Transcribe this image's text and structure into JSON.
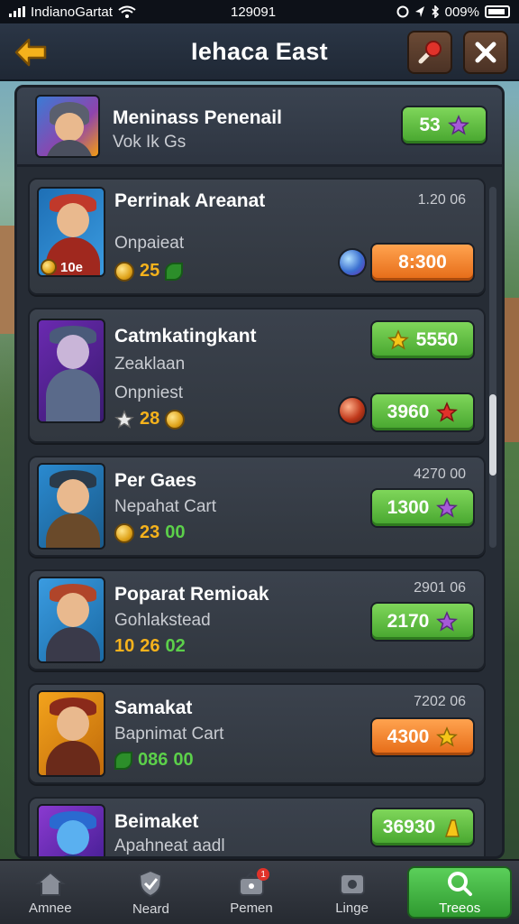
{
  "status_bar": {
    "carrier": "IndianoGartat",
    "time": "129091",
    "battery": "009%"
  },
  "header": {
    "title": "Iehaca East"
  },
  "top_item": {
    "title": "Meninass Penenail",
    "subtitle": "Vok Ik Gs",
    "price": "53"
  },
  "items": [
    {
      "title": "Perrinak Areanat",
      "time": "1.20 06",
      "line1": "Onpaieat",
      "stats": [
        "25"
      ],
      "level": "10e",
      "price": "8:300",
      "button_color": "orange"
    },
    {
      "title": "Catmkatingkant",
      "line1": "Zeaklaan",
      "line2": "Onpniest",
      "stats": [
        "28"
      ],
      "price_top": "5550",
      "price": "3960",
      "button_color": "green"
    },
    {
      "title": "Per Gaes",
      "time": "4270 00",
      "line1": "Nepahat Cart",
      "stats": [
        "23",
        "00"
      ],
      "price": "1300",
      "button_color": "green"
    },
    {
      "title": "Poparat Remioak",
      "time": "2901 06",
      "line1": "Gohlakstead",
      "stats": [
        "10",
        "26",
        "02"
      ],
      "price": "2170",
      "button_color": "green"
    },
    {
      "title": "Samakat",
      "time": "7202 06",
      "line1": "Bapnimat Cart",
      "stats": [
        "086",
        "00"
      ],
      "price": "4300",
      "button_color": "orange"
    },
    {
      "title": "Beimaket",
      "line1": "Apahneat aadl",
      "price": "36930",
      "button_color": "green"
    }
  ],
  "bottom_nav": [
    {
      "label": "Amnee",
      "icon": "home-icon"
    },
    {
      "label": "Neard",
      "icon": "shield-check-icon"
    },
    {
      "label": "Pemen",
      "icon": "bag-icon",
      "badge": "1"
    },
    {
      "label": "Linge",
      "icon": "chest-icon"
    },
    {
      "label": "Treeos",
      "icon": "search-icon",
      "active": true
    }
  ],
  "colors": {
    "green_button": "#46a52e",
    "orange_button": "#e56a16",
    "panel_bg": "#262c35",
    "card_bg": "#353b45"
  }
}
